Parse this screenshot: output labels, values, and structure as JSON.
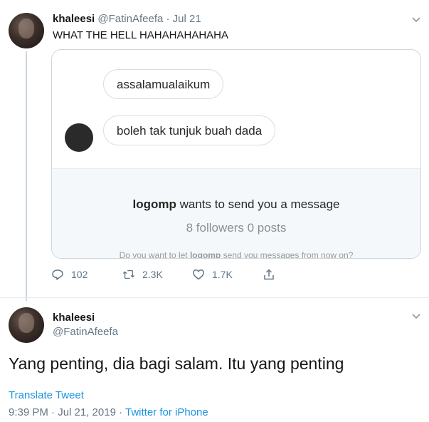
{
  "tweet1": {
    "display_name": "khaleesi",
    "handle": "@FatinAfeefa",
    "time": "· Jul 21",
    "text": "WHAT THE HELL HAHAHAHAHAHA",
    "card": {
      "bubble1": "assalamualaikum",
      "bubble2": "boleh tak tunjuk buah dada",
      "request_user": "logomp",
      "request_text": " wants to send you a message",
      "stats": "8 followers 0 posts",
      "cut_prefix": "Do you want to let ",
      "cut_user": "logomp",
      "cut_suffix": " send you messages from now on?"
    },
    "actions": {
      "replies": "102",
      "retweets": "2.3K",
      "likes": "1.7K"
    }
  },
  "tweet2": {
    "display_name": "khaleesi",
    "handle": "@FatinAfeefa",
    "text": "Yang penting, dia bagi salam. Itu yang penting",
    "translate": "Translate Tweet",
    "timestamp": "9:39 PM · Jul 21, 2019 · ",
    "source": "Twitter for iPhone"
  },
  "icons": {
    "reply": "reply-icon",
    "retweet": "retweet-icon",
    "like": "heart-icon",
    "share": "share-icon",
    "menu": "chevron-down-icon"
  },
  "colors": {
    "accent": "#1b95e0",
    "muted": "#657786",
    "border": "#ccd6dd"
  }
}
